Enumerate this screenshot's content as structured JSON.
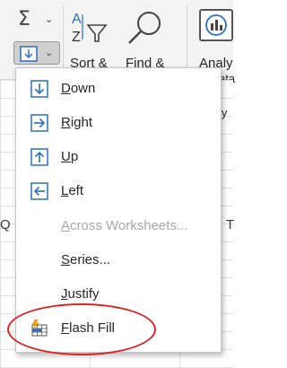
{
  "ribbon": {
    "autosum_icon": "sigma-icon",
    "sort_filter_label": "Sort &",
    "find_select_label": "Find &",
    "analyze_label": "Analy",
    "analyze_line2": "ata",
    "analyze_line3": "ly"
  },
  "fill_menu": {
    "items": [
      {
        "icon": "fill-down-icon",
        "accel": "D",
        "rest": "own",
        "enabled": true
      },
      {
        "icon": "fill-right-icon",
        "accel": "R",
        "rest": "ight",
        "enabled": true
      },
      {
        "icon": "fill-up-icon",
        "accel": "U",
        "rest": "p",
        "enabled": true
      },
      {
        "icon": "fill-left-icon",
        "accel": "L",
        "rest": "eft",
        "enabled": true
      },
      {
        "icon": "",
        "accel": "A",
        "rest": "cross Worksheets...",
        "enabled": false
      },
      {
        "icon": "",
        "accel": "S",
        "rest": "eries...",
        "enabled": true
      },
      {
        "icon": "",
        "accel": "J",
        "rest": "ustify",
        "enabled": true
      },
      {
        "icon": "flash-fill-icon",
        "accel": "F",
        "rest": "lash Fill",
        "enabled": true
      }
    ]
  },
  "grid": {
    "left_header_fragment": "Q",
    "right_header_fragment": "T"
  },
  "colors": {
    "accent_blue": "#2b6fc0",
    "highlight_red": "#d9242a",
    "disabled_text": "#a6a6a6"
  }
}
